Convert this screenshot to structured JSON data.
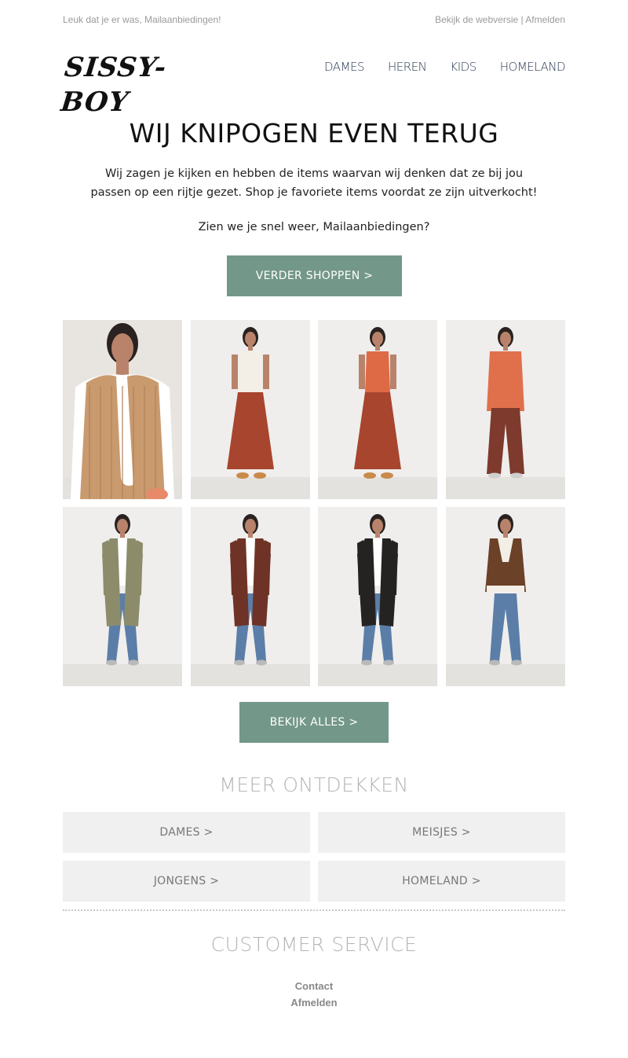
{
  "topbar": {
    "greeting": "Leuk dat je er was, Mailaanbiedingen!",
    "webversion": "Bekijk de webversie",
    "separator": " | ",
    "unsubscribe": "Afmelden"
  },
  "logo": {
    "text": "SISSY-BOY"
  },
  "nav": {
    "items": [
      "DAMES",
      "HEREN",
      "KIDS",
      "HOMELAND"
    ]
  },
  "hero": {
    "title": "WIJ KNIPOGEN EVEN TERUG",
    "intro": "Wij zagen je kijken en hebben de items waarvan wij denken dat ze bij jou passen op een rijtje gezet. Shop je favoriete items voordat ze zijn uitverkocht!",
    "greeting": "Zien we je snel weer, Mailaanbiedingen?",
    "cta": "VERDER SHOPPEN >"
  },
  "products": {
    "items": [
      {
        "id": "p1",
        "kind": "vest",
        "garment": "#c99a6e",
        "bottom": "#c99a6e",
        "bg": "#e8e4df"
      },
      {
        "id": "p2",
        "kind": "top-skirt",
        "garment": "#f4efe6",
        "bottom": "#a8452e",
        "bg": "#efeeec"
      },
      {
        "id": "p3",
        "kind": "top-skirt",
        "garment": "#de6a45",
        "bottom": "#a8452e",
        "bg": "#efeeec"
      },
      {
        "id": "p4",
        "kind": "shirt-pants",
        "garment": "#e0704c",
        "bottom": "#7e3a2d",
        "bg": "#efeeec"
      },
      {
        "id": "p5",
        "kind": "coat",
        "garment": "#8d8c6a",
        "bottom": "#5b7ea8",
        "bg": "#efeeec"
      },
      {
        "id": "p6",
        "kind": "coat",
        "garment": "#6e3326",
        "bottom": "#5b7ea8",
        "bg": "#efeeec"
      },
      {
        "id": "p7",
        "kind": "coat",
        "garment": "#252322",
        "bottom": "#5b7ea8",
        "bg": "#efeeec"
      },
      {
        "id": "p8",
        "kind": "jacket",
        "garment": "#6b4128",
        "bottom": "#5b7ea8",
        "bg": "#efeeec"
      }
    ],
    "cta": "BEKIJK ALLES >"
  },
  "discover": {
    "title": "MEER ONTDEKKEN",
    "categories": [
      "DAMES >",
      "MEISJES >",
      "JONGENS >",
      "HOMELAND >"
    ]
  },
  "customer_service": {
    "title": "CUSTOMER SERVICE",
    "links": [
      "Contact",
      "Afmelden"
    ]
  }
}
